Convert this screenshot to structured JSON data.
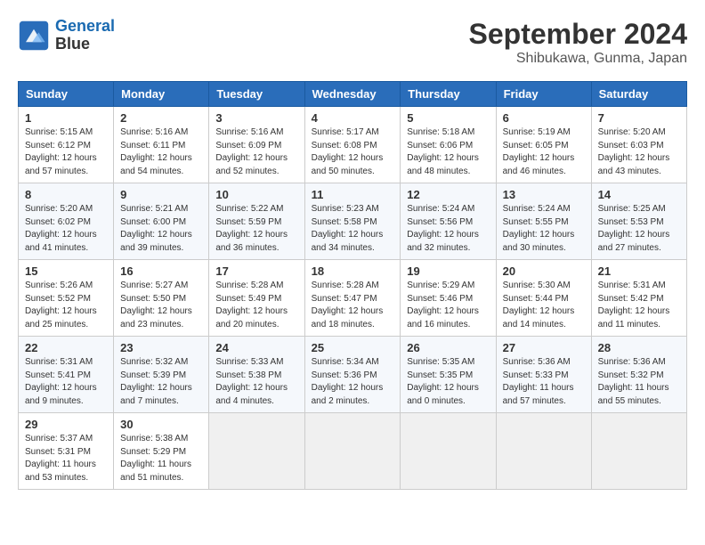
{
  "header": {
    "logo_line1": "General",
    "logo_line2": "Blue",
    "month": "September 2024",
    "location": "Shibukawa, Gunma, Japan"
  },
  "weekdays": [
    "Sunday",
    "Monday",
    "Tuesday",
    "Wednesday",
    "Thursday",
    "Friday",
    "Saturday"
  ],
  "weeks": [
    [
      {
        "day": "1",
        "info": "Sunrise: 5:15 AM\nSunset: 6:12 PM\nDaylight: 12 hours\nand 57 minutes."
      },
      {
        "day": "2",
        "info": "Sunrise: 5:16 AM\nSunset: 6:11 PM\nDaylight: 12 hours\nand 54 minutes."
      },
      {
        "day": "3",
        "info": "Sunrise: 5:16 AM\nSunset: 6:09 PM\nDaylight: 12 hours\nand 52 minutes."
      },
      {
        "day": "4",
        "info": "Sunrise: 5:17 AM\nSunset: 6:08 PM\nDaylight: 12 hours\nand 50 minutes."
      },
      {
        "day": "5",
        "info": "Sunrise: 5:18 AM\nSunset: 6:06 PM\nDaylight: 12 hours\nand 48 minutes."
      },
      {
        "day": "6",
        "info": "Sunrise: 5:19 AM\nSunset: 6:05 PM\nDaylight: 12 hours\nand 46 minutes."
      },
      {
        "day": "7",
        "info": "Sunrise: 5:20 AM\nSunset: 6:03 PM\nDaylight: 12 hours\nand 43 minutes."
      }
    ],
    [
      {
        "day": "8",
        "info": "Sunrise: 5:20 AM\nSunset: 6:02 PM\nDaylight: 12 hours\nand 41 minutes."
      },
      {
        "day": "9",
        "info": "Sunrise: 5:21 AM\nSunset: 6:00 PM\nDaylight: 12 hours\nand 39 minutes."
      },
      {
        "day": "10",
        "info": "Sunrise: 5:22 AM\nSunset: 5:59 PM\nDaylight: 12 hours\nand 36 minutes."
      },
      {
        "day": "11",
        "info": "Sunrise: 5:23 AM\nSunset: 5:58 PM\nDaylight: 12 hours\nand 34 minutes."
      },
      {
        "day": "12",
        "info": "Sunrise: 5:24 AM\nSunset: 5:56 PM\nDaylight: 12 hours\nand 32 minutes."
      },
      {
        "day": "13",
        "info": "Sunrise: 5:24 AM\nSunset: 5:55 PM\nDaylight: 12 hours\nand 30 minutes."
      },
      {
        "day": "14",
        "info": "Sunrise: 5:25 AM\nSunset: 5:53 PM\nDaylight: 12 hours\nand 27 minutes."
      }
    ],
    [
      {
        "day": "15",
        "info": "Sunrise: 5:26 AM\nSunset: 5:52 PM\nDaylight: 12 hours\nand 25 minutes."
      },
      {
        "day": "16",
        "info": "Sunrise: 5:27 AM\nSunset: 5:50 PM\nDaylight: 12 hours\nand 23 minutes."
      },
      {
        "day": "17",
        "info": "Sunrise: 5:28 AM\nSunset: 5:49 PM\nDaylight: 12 hours\nand 20 minutes."
      },
      {
        "day": "18",
        "info": "Sunrise: 5:28 AM\nSunset: 5:47 PM\nDaylight: 12 hours\nand 18 minutes."
      },
      {
        "day": "19",
        "info": "Sunrise: 5:29 AM\nSunset: 5:46 PM\nDaylight: 12 hours\nand 16 minutes."
      },
      {
        "day": "20",
        "info": "Sunrise: 5:30 AM\nSunset: 5:44 PM\nDaylight: 12 hours\nand 14 minutes."
      },
      {
        "day": "21",
        "info": "Sunrise: 5:31 AM\nSunset: 5:42 PM\nDaylight: 12 hours\nand 11 minutes."
      }
    ],
    [
      {
        "day": "22",
        "info": "Sunrise: 5:31 AM\nSunset: 5:41 PM\nDaylight: 12 hours\nand 9 minutes."
      },
      {
        "day": "23",
        "info": "Sunrise: 5:32 AM\nSunset: 5:39 PM\nDaylight: 12 hours\nand 7 minutes."
      },
      {
        "day": "24",
        "info": "Sunrise: 5:33 AM\nSunset: 5:38 PM\nDaylight: 12 hours\nand 4 minutes."
      },
      {
        "day": "25",
        "info": "Sunrise: 5:34 AM\nSunset: 5:36 PM\nDaylight: 12 hours\nand 2 minutes."
      },
      {
        "day": "26",
        "info": "Sunrise: 5:35 AM\nSunset: 5:35 PM\nDaylight: 12 hours\nand 0 minutes."
      },
      {
        "day": "27",
        "info": "Sunrise: 5:36 AM\nSunset: 5:33 PM\nDaylight: 11 hours\nand 57 minutes."
      },
      {
        "day": "28",
        "info": "Sunrise: 5:36 AM\nSunset: 5:32 PM\nDaylight: 11 hours\nand 55 minutes."
      }
    ],
    [
      {
        "day": "29",
        "info": "Sunrise: 5:37 AM\nSunset: 5:31 PM\nDaylight: 11 hours\nand 53 minutes."
      },
      {
        "day": "30",
        "info": "Sunrise: 5:38 AM\nSunset: 5:29 PM\nDaylight: 11 hours\nand 51 minutes."
      },
      {
        "day": "",
        "info": ""
      },
      {
        "day": "",
        "info": ""
      },
      {
        "day": "",
        "info": ""
      },
      {
        "day": "",
        "info": ""
      },
      {
        "day": "",
        "info": ""
      }
    ]
  ]
}
